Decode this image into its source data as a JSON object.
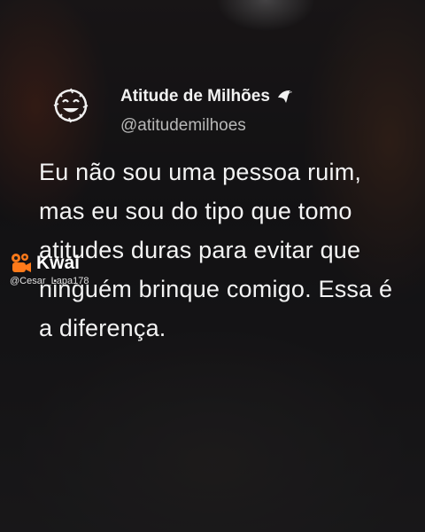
{
  "profile": {
    "display_name": "Atitude de Milhões",
    "handle": "@atitudemilhoes"
  },
  "tweet": {
    "text": "Eu não sou uma pessoa ruim, mas eu sou do tipo que tomo atitudes duras para evitar que ninguém brinque comigo. Essa é a diferença."
  },
  "watermark": {
    "brand": "Kwai",
    "user": "@Cesar_Lapa178"
  },
  "colors": {
    "text": "#f3f3f3",
    "handle": "#b8b8b8",
    "brand_orange": "#ff7a1a"
  },
  "icons": {
    "avatar": "smiley-face-icon",
    "badge": "eagle-icon",
    "watermark_logo": "kwai-logo-icon"
  }
}
